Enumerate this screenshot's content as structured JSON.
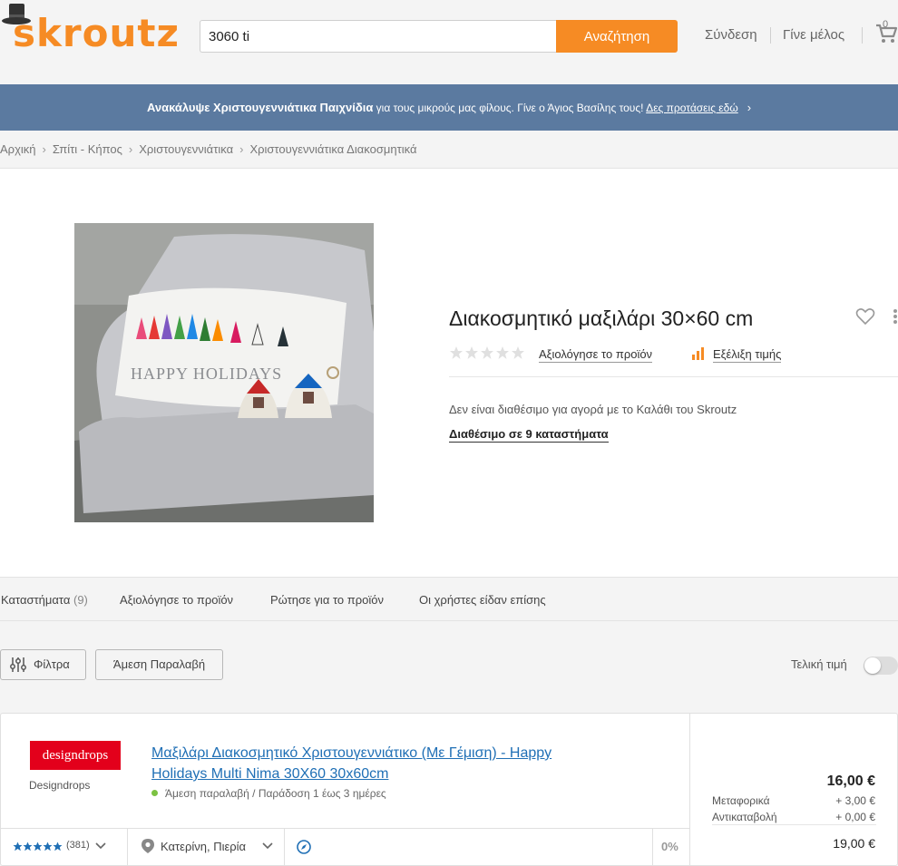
{
  "header": {
    "logo_text": "skroutz",
    "search_value": "3060 ti",
    "search_button": "Αναζήτηση",
    "login": "Σύνδεση",
    "signup": "Γίνε μέλος",
    "cart_count": "0",
    "brand_color": "#f68b24"
  },
  "banner": {
    "bold": "Ανακάλυψε Χριστουγεννιάτικα Παιχνίδια",
    "text": " για τους μικρούς μας φίλους. Γίνε ο Άγιος Βασίλης τους! ",
    "link": "Δες προτάσεις εδώ",
    "chevron": "›",
    "bg_color": "#5b7aa0"
  },
  "breadcrumb": {
    "items": [
      "Αρχική",
      "Σπίτι - Κήπος",
      "Χριστουγεννιάτικα",
      "Χριστουγεννιάτικα Διακοσμητικά"
    ],
    "separator": "›"
  },
  "product": {
    "title": "Διακοσμητικό μαξιλάρι 30×60 cm",
    "image_text": "HAPPY HOLIDAYS",
    "rating_link": "Αξιολόγησε το προϊόν",
    "price_trend": "Εξέλιξη τιμής",
    "availability_note": "Δεν είναι διαθέσιμο για αγορά με το Καλάθι του Skroutz",
    "availability_link": "Διαθέσιμο σε 9 καταστήματα"
  },
  "tabs": [
    {
      "label": "Καταστήματα",
      "count": "(9)"
    },
    {
      "label": "Αξιολόγησε το προϊόν",
      "count": ""
    },
    {
      "label": "Ρώτησε για το προϊόν",
      "count": ""
    },
    {
      "label": "Οι χρήστες είδαν επίσης",
      "count": ""
    }
  ],
  "filters": {
    "filters_button": "Φίλτρα",
    "pickup_button": "Άμεση Παραλαβή",
    "total_price_label": "Τελική τιμή"
  },
  "offer": {
    "shop_logo_text": "designdrops",
    "shop_name": "Designdrops",
    "title_line1": "Μαξιλάρι Διακοσμητικό Χριστουγεννιάτικο (Με Γέμιση) - Happy",
    "title_line2": "Holidays Multi Nima 30X60 30x60cm",
    "delivery": "Άμεση παραλαβή / Παράδοση 1 έως 3 ημέρες",
    "rating_count": "(381)",
    "location": "Κατερίνη, Πιερία",
    "percent": "0%",
    "price": "16,00 €",
    "shipping_label": "Μεταφορικά",
    "shipping_value": "+ 3,00 €",
    "cod_label": "Αντικαταβολή",
    "cod_value": "+ 0,00 €",
    "total": "19,00 €"
  }
}
